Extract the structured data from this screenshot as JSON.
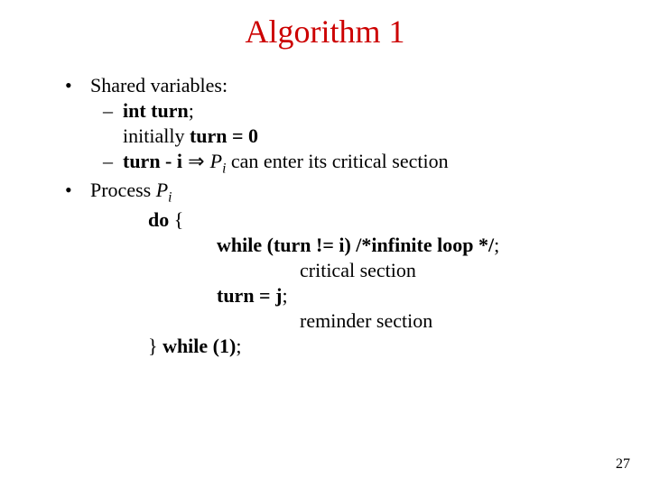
{
  "title": "Algorithm 1",
  "lines": {
    "l1": "Shared variables:",
    "l2a": "int turn",
    "l2b": ";",
    "l3a": "initially ",
    "l3b": "turn = 0",
    "l4a": "turn - i",
    "l4arrow": " ⇒ ",
    "l4b": "P",
    "l4sub": "i",
    "l4c": " can enter its critical section",
    "l5a": "Process ",
    "l5b": "P",
    "l5sub": "i",
    "l6": "do",
    "l6b": " {",
    "l7": "while (turn != i) /*infinite loop */",
    "l7b": ";",
    "l8": "critical section",
    "l9": "turn = j",
    "l9b": ";",
    "l10": "reminder section",
    "l11a": "} ",
    "l11b": "while (1)",
    "l11c": ";"
  },
  "page_number": "27"
}
